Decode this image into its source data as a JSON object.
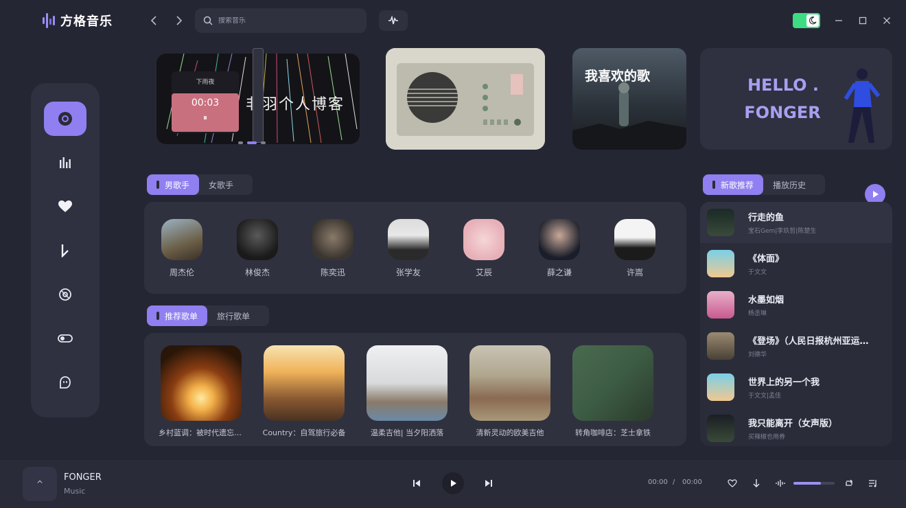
{
  "app": {
    "title": "方格音乐",
    "brand_color": "#8f7ff0"
  },
  "search": {
    "placeholder": "搜索音乐"
  },
  "banners": [
    {
      "id": "b1",
      "text": "非羽个人博客",
      "player_title": "下雨夜",
      "player_time": "00:03"
    },
    {
      "id": "b2",
      "text": ""
    },
    {
      "id": "b3",
      "text": "我喜欢的歌"
    },
    {
      "id": "b4",
      "line1": "HELLO .",
      "line2": "FONGER"
    }
  ],
  "singer_tabs": [
    {
      "label": "男歌手",
      "active": true
    },
    {
      "label": "女歌手",
      "active": false
    }
  ],
  "singers": [
    "周杰伦",
    "林俊杰",
    "陈奕迅",
    "张学友",
    "艾辰",
    "薛之谦",
    "许嵩"
  ],
  "playlist_tabs": [
    {
      "label": "推荐歌单",
      "active": true
    },
    {
      "label": "旅行歌单",
      "active": false
    }
  ],
  "playlists": [
    "乡村蓝调：被时代遗忘的声音",
    "Country：自驾旅行必备",
    "温柔吉他| 当夕阳洒落",
    "清新灵动的欧美吉他",
    "转角咖啡店：芝士拿铁"
  ],
  "song_tabs": [
    {
      "label": "新歌推荐",
      "active": true
    },
    {
      "label": "播放历史",
      "active": false
    }
  ],
  "songs": [
    {
      "title": "行走的鱼",
      "artist": "宝石Gem|李玖哲|陈楚生"
    },
    {
      "title": "《体面》",
      "artist": "于文文"
    },
    {
      "title": "水墨如烟",
      "artist": "杨丞琳"
    },
    {
      "title": "《登场》（人民日报杭州亚运会主题曲）",
      "artist": "刘德华"
    },
    {
      "title": "世界上的另一个我",
      "artist": "于文文|孟佳"
    },
    {
      "title": "我只能离开（女声版）",
      "artist": "买辣椒也用券"
    }
  ],
  "player": {
    "title": "FONGER",
    "subtitle": "Music",
    "current": "00:00",
    "sep": "/",
    "total": "00:00",
    "volume": 0.66,
    "collapse_glyph": "^"
  }
}
